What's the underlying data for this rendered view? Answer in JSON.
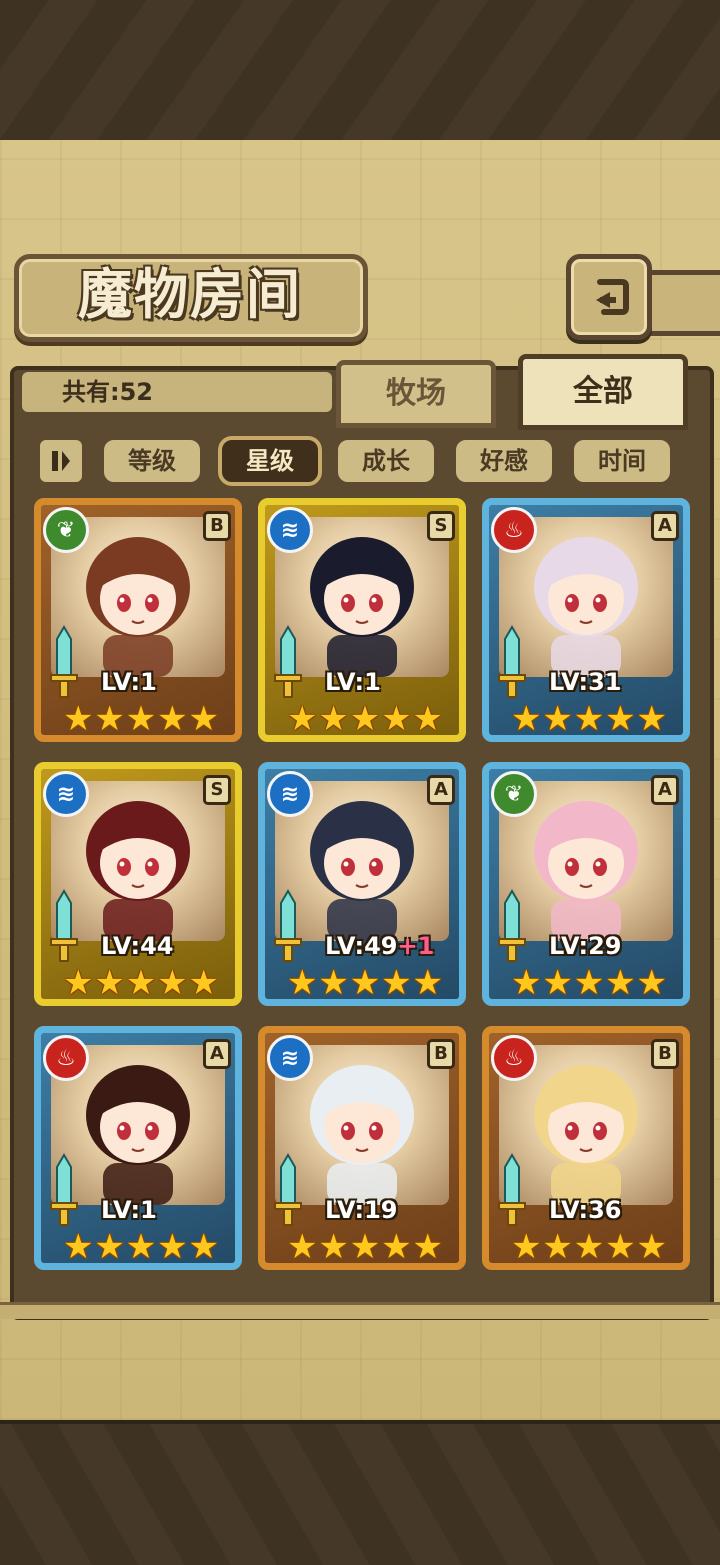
{
  "header": {
    "title": "魔物房间",
    "back_icon": "return-arrow-icon"
  },
  "summary": {
    "count_label": "共有:52"
  },
  "tabs": [
    {
      "label": "牧场",
      "active": false
    },
    {
      "label": "全部",
      "active": true
    }
  ],
  "sort": {
    "toggle_icon": "pause-toggle-icon",
    "buttons": [
      {
        "label": "等级",
        "active": false
      },
      {
        "label": "星级",
        "active": true
      },
      {
        "label": "成长",
        "active": false
      },
      {
        "label": "好感",
        "active": false
      },
      {
        "label": "时间",
        "active": false
      }
    ]
  },
  "monsters": [
    {
      "element": "grass",
      "rank": "B",
      "level": "LV:1",
      "plus": "",
      "stars": 5
    },
    {
      "element": "water",
      "rank": "S",
      "level": "LV:1",
      "plus": "",
      "stars": 5
    },
    {
      "element": "fire",
      "rank": "A",
      "level": "LV:31",
      "plus": "",
      "stars": 5
    },
    {
      "element": "water",
      "rank": "S",
      "level": "LV:44",
      "plus": "",
      "stars": 5
    },
    {
      "element": "water",
      "rank": "A",
      "level": "LV:49",
      "plus": "+1",
      "stars": 5
    },
    {
      "element": "grass",
      "rank": "A",
      "level": "LV:29",
      "plus": "",
      "stars": 5
    },
    {
      "element": "fire",
      "rank": "A",
      "level": "LV:1",
      "plus": "",
      "stars": 5
    },
    {
      "element": "water",
      "rank": "B",
      "level": "LV:19",
      "plus": "",
      "stars": 5
    },
    {
      "element": "fire",
      "rank": "B",
      "level": "LV:36",
      "plus": "",
      "stars": 5
    }
  ],
  "colors": {
    "rank_B": "#d58b2c",
    "rank_S": "#e9cc2d",
    "rank_A": "#5fb4dd",
    "element_grass": "#3e8a2d",
    "element_water": "#1d6fc4",
    "element_fire": "#c9231d"
  }
}
